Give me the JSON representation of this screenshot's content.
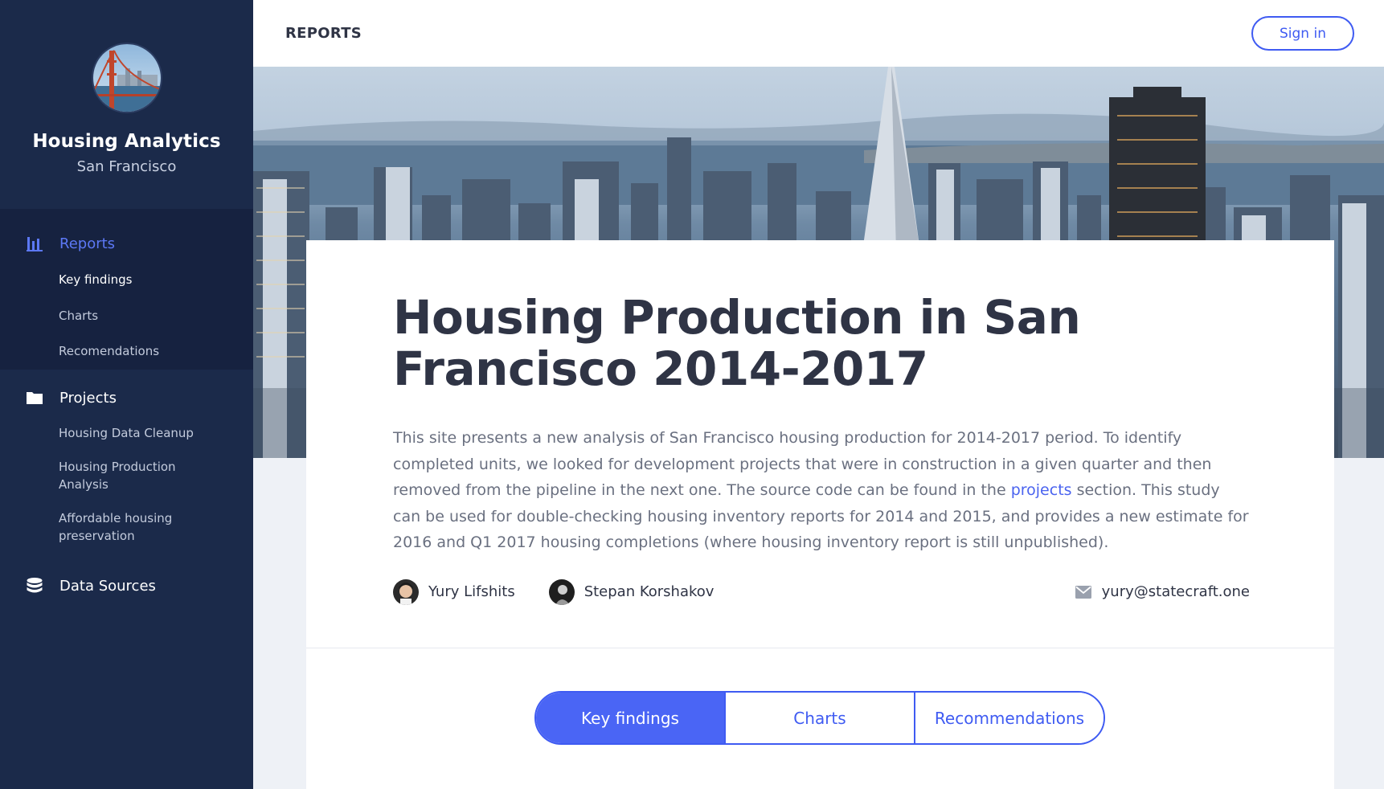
{
  "sidebar": {
    "brand_title": "Housing Analytics",
    "brand_subtitle": "San Francisco",
    "groups": [
      {
        "label": "Reports",
        "icon": "bar-chart-icon",
        "active": true,
        "items": [
          {
            "label": "Key findings",
            "current": true
          },
          {
            "label": "Charts"
          },
          {
            "label": "Recomendations"
          }
        ]
      },
      {
        "label": "Projects",
        "icon": "folder-icon",
        "items": [
          {
            "label": "Housing Data Cleanup"
          },
          {
            "label": "Housing Production Analysis"
          },
          {
            "label": "Affordable housing preservation"
          }
        ]
      },
      {
        "label": "Data Sources",
        "icon": "database-icon",
        "items": []
      }
    ]
  },
  "topbar": {
    "section_title": "REPORTS",
    "signin_label": "Sign in"
  },
  "article": {
    "title": "Housing Production in San Francisco 2014-2017",
    "intro_before_link": "This site presents a new analysis of San Francisco housing production for 2014-2017 period. To identify completed units, we looked for development projects that were in construction in a given quarter and then removed from the pipeline in the next one. The source code can be found in the ",
    "intro_link": "projects",
    "intro_after_link": " section. This study can be used for double-checking housing inventory reports for 2014 and 2015, and provides a new estimate for 2016 and Q1 2017 housing completions (where housing inventory report is still unpublished).",
    "authors": [
      {
        "name": "Yury Lifshits"
      },
      {
        "name": "Stepan Korshakov"
      }
    ],
    "contact_email": "yury@statecraft.one"
  },
  "tabs": [
    {
      "label": "Key findings",
      "active": true
    },
    {
      "label": "Charts"
    },
    {
      "label": "Recommendations"
    }
  ],
  "colors": {
    "sidebar_bg": "#1b2a4a",
    "accent": "#3f5bf2",
    "heading": "#2f3445",
    "body_text": "#6a7080"
  }
}
